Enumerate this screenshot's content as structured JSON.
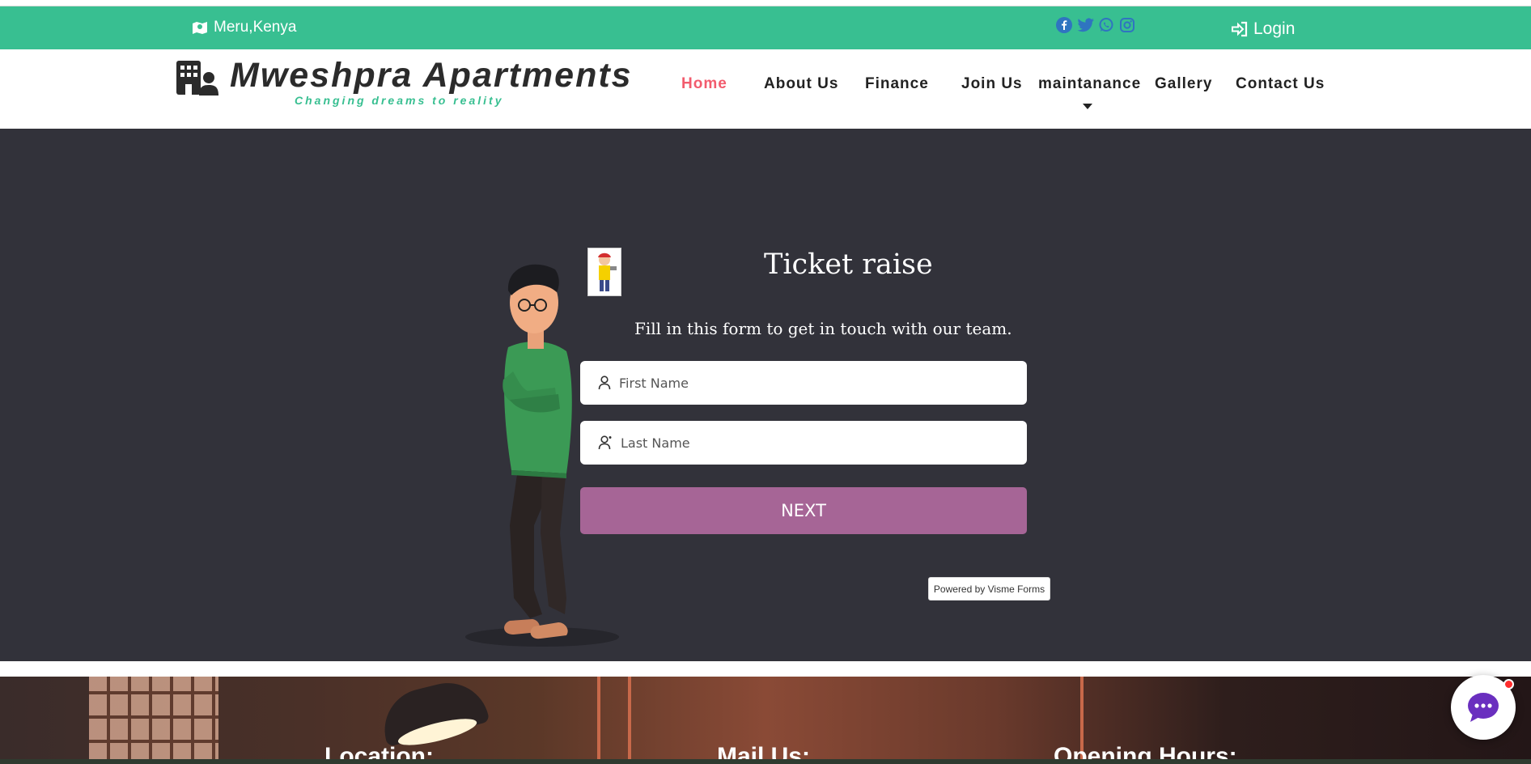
{
  "topbar": {
    "location": "Meru,Kenya",
    "social": [
      "facebook-icon",
      "twitter-icon",
      "whatsapp-icon",
      "instagram-icon"
    ],
    "login_label": "Login"
  },
  "brand": {
    "name": "Mweshpra Apartments",
    "tagline": "Changing dreams to reality"
  },
  "nav": {
    "items": [
      {
        "label": "Home",
        "active": true
      },
      {
        "label": "About Us"
      },
      {
        "label": "Finance"
      },
      {
        "label": "Join Us"
      },
      {
        "label": "maintanance"
      },
      {
        "label": "Gallery"
      },
      {
        "label": "Contact Us"
      }
    ]
  },
  "form": {
    "title": "Ticket raise",
    "subtitle": "Fill in this form to get in touch with our team.",
    "first_name_placeholder": "First Name",
    "last_name_placeholder": "Last Name",
    "next_label": "NEXT",
    "powered_by": "Powered by Visme Forms"
  },
  "footer": {
    "location_heading": "Location:",
    "mail_heading": "Mail Us:",
    "hours_heading": "Opening Hours:"
  },
  "colors": {
    "brand_green": "#38bf91",
    "active_nav": "#f25b6d",
    "hero_bg": "#32323a",
    "button": "#a66596",
    "chat_accent": "#6a2fbf"
  }
}
